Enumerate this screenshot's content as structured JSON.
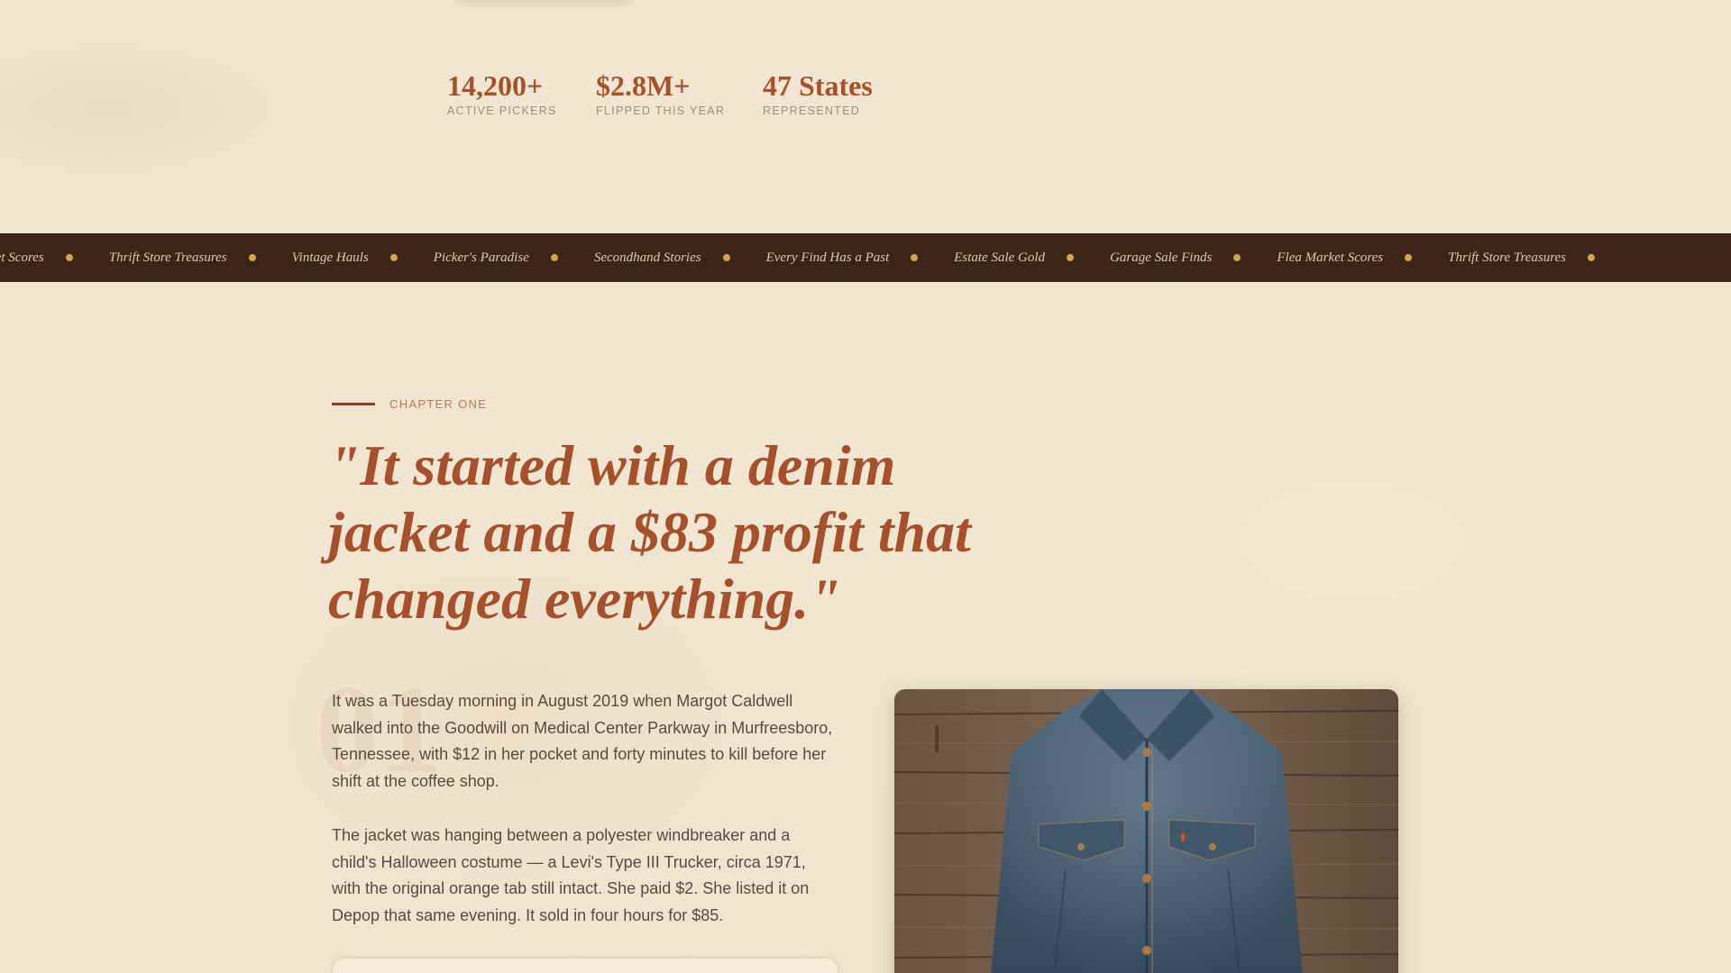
{
  "stats": [
    {
      "value": "14,200+",
      "label": "ACTIVE PICKERS"
    },
    {
      "value": "$2.8M+",
      "label": "FLIPPED THIS YEAR"
    },
    {
      "value": "47 States",
      "label": "REPRESENTED"
    }
  ],
  "ticker": {
    "items": [
      "Flea Market Scores",
      "Thrift Store Treasures",
      "Vintage Hauls",
      "Picker's Paradise",
      "Secondhand Stories",
      "Every Find Has a Past",
      "Estate Sale Gold",
      "Garage Sale Finds",
      "Flea Market Scores",
      "Thrift Store Treasures"
    ]
  },
  "chapter": {
    "label": "CHAPTER ONE",
    "number": "01",
    "quote": "\"It started with a denim jacket and a $83 profit that changed everything.\"",
    "paragraphs": [
      "It was a Tuesday morning in August 2019 when Margot Caldwell walked into the Goodwill on Medical Center Parkway in Murfreesboro, Tennessee, with $12 in her pocket and forty minutes to kill before her shift at the coffee shop.",
      "The jacket was hanging between a polyester windbreaker and a child's Halloween costume — a Levi's Type III Trucker, circa 1971, with the original orange tab still intact. She paid $2. She listed it on Depop that same evening. It sold in four hours for $85."
    ]
  },
  "photo": {
    "icon": "denim-jacket-photo"
  },
  "colors": {
    "background": "#f3e8d6",
    "accent": "#a5512a",
    "ticker_bg": "#3a2517",
    "ticker_dot": "#d3a44b",
    "body_text": "#5a4a3c"
  }
}
